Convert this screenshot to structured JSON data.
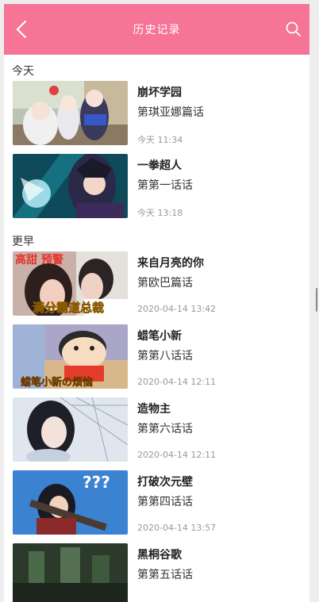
{
  "header": {
    "title": "历史记录",
    "back_icon": "chevron-left-icon",
    "search_icon": "search-icon",
    "color": "#f67496"
  },
  "sections": [
    {
      "label": "今天",
      "items": [
        {
          "title": "崩坏学园",
          "episode": "第琪亚娜篇话",
          "time": "今天 11:34"
        },
        {
          "title": "一拳超人",
          "episode": "第第一话话",
          "time": "今天 13:18"
        }
      ]
    },
    {
      "label": "更早",
      "items": [
        {
          "title": "来自月亮的你",
          "episode": "第欧巴篇话",
          "time": "2020-04-14 13:42",
          "thumb_text_top": "高甜 预警",
          "thumb_text_bottom": "满分霸道总裁"
        },
        {
          "title": "蜡笔小新",
          "episode": "第第八话话",
          "time": "2020-04-14 12:11",
          "thumb_text_bottom": "蜡笔小新の烦恼"
        },
        {
          "title": "造物主",
          "episode": "第第六话话",
          "time": "2020-04-14 12:11"
        },
        {
          "title": "打破次元壁",
          "episode": "第第四话话",
          "time": "2020-04-14 13:57",
          "thumb_text_top": "???"
        },
        {
          "title": "黑桐谷歌",
          "episode": "第第五话话",
          "time": ""
        }
      ]
    }
  ]
}
